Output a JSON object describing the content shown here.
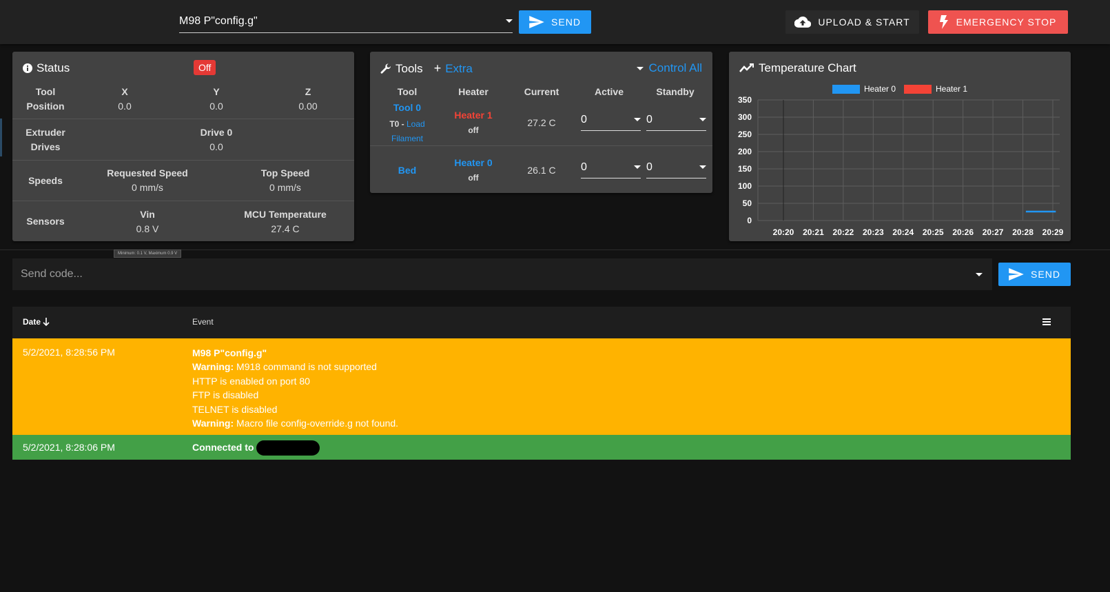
{
  "topbar": {
    "command_value": "M98 P\"config.g\"",
    "send_label": "SEND",
    "upload_label": "UPLOAD & START",
    "estop_label": "EMERGENCY STOP"
  },
  "status": {
    "title": "Status",
    "state_badge": "Off",
    "tool_label": "Tool",
    "position_label": "Position",
    "axes": [
      {
        "name": "X",
        "value": "0.0"
      },
      {
        "name": "Y",
        "value": "0.0"
      },
      {
        "name": "Z",
        "value": "0.00"
      }
    ],
    "extruder_label": "Extruder",
    "drives_label": "Drives",
    "drive0_label": "Drive 0",
    "drive0_value": "0.0",
    "speeds_label": "Speeds",
    "requested_speed_label": "Requested Speed",
    "requested_speed_value": "0 mm/s",
    "top_speed_label": "Top Speed",
    "top_speed_value": "0 mm/s",
    "sensors_label": "Sensors",
    "vin_label": "Vin",
    "vin_value": "0.8 V",
    "mcu_label": "MCU Temperature",
    "mcu_value": "27.4 C",
    "vin_tooltip": "Minimum: 0.1 V, Maximum 0.9 V"
  },
  "tools": {
    "title": "Tools",
    "extra_label": "Extra",
    "control_all_label": "Control All",
    "headers": {
      "tool": "Tool",
      "heater": "Heater",
      "current": "Current",
      "active": "Active",
      "standby": "Standby"
    },
    "rows": [
      {
        "tool": "Tool 0",
        "tool_sub_prefix": "T0 - ",
        "tool_sub_link": "Load",
        "tool_sub_link2": "Filament",
        "heater": "Heater 1",
        "heater_state": "off",
        "current": "27.2 C",
        "active": "0",
        "standby": "0"
      },
      {
        "tool": "Bed",
        "heater": "Heater 0",
        "heater_state": "off",
        "current": "26.1 C",
        "active": "0",
        "standby": "0"
      }
    ]
  },
  "temp_chart": {
    "title": "Temperature Chart",
    "chart_data": {
      "type": "line",
      "title": "",
      "xlabel": "",
      "ylabel": "",
      "ylim": [
        0,
        350
      ],
      "y_ticks": [
        "0",
        "50",
        "100",
        "150",
        "200",
        "250",
        "300",
        "350"
      ],
      "categories": [
        "20:20",
        "20:21",
        "20:22",
        "20:23",
        "20:24",
        "20:25",
        "20:26",
        "20:27",
        "20:28",
        "20:29"
      ],
      "series": [
        {
          "name": "Heater 0",
          "color": "#2196f3",
          "points": [
            [
              8.1,
              26
            ],
            [
              9.1,
              26
            ]
          ]
        },
        {
          "name": "Heater 1",
          "color": "#f44336",
          "points": []
        }
      ],
      "grid": true,
      "legend": "top-center"
    }
  },
  "console": {
    "input_placeholder": "Send code...",
    "send_label": "SEND",
    "header_date": "Date",
    "header_event": "Event",
    "rows": [
      {
        "date": "5/2/2021, 8:28:56 PM",
        "lines": [
          {
            "bold": "M98 P\"config.g\"",
            "text": ""
          },
          {
            "bold": "Warning:",
            "text": " M918 command is not supported"
          },
          {
            "bold": "",
            "text": "HTTP is enabled on port 80"
          },
          {
            "bold": "",
            "text": "FTP is disabled"
          },
          {
            "bold": "",
            "text": "TELNET is disabled"
          },
          {
            "bold": "Warning:",
            "text": " Macro file config-override.g not found."
          }
        ]
      },
      {
        "date": "5/2/2021, 8:28:06 PM",
        "connected_text": "Connected to"
      }
    ]
  },
  "colors": {
    "primary": "#2196f3",
    "danger": "#ef5350",
    "warning_row": "#ffb300",
    "success_row": "#43a047",
    "card_bg": "#424242"
  }
}
